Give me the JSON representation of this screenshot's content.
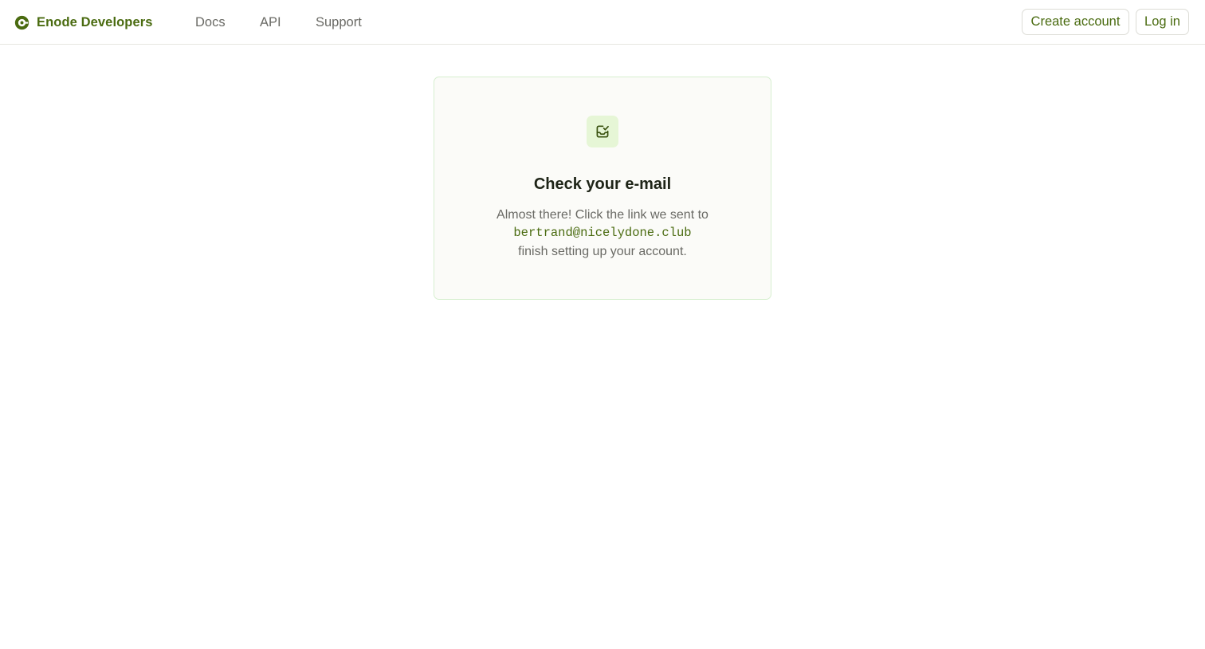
{
  "header": {
    "brand_name": "Enode Developers",
    "brand_icon": "enode-logo-icon",
    "nav": {
      "docs": "Docs",
      "api": "API",
      "support": "Support"
    },
    "create_account_label": "Create account",
    "login_label": "Log in"
  },
  "card": {
    "icon": "inbox-check-icon",
    "title": "Check your e-mail",
    "line1": "Almost there! Click the link we sent to",
    "email": "bertrand@nicelydone.club",
    "line3": "finish setting up your account."
  },
  "colors": {
    "accent": "#4a6b10",
    "card_border": "#d6efcf",
    "icon_bg": "#e6f6d6",
    "muted_text": "#6a6a65"
  }
}
